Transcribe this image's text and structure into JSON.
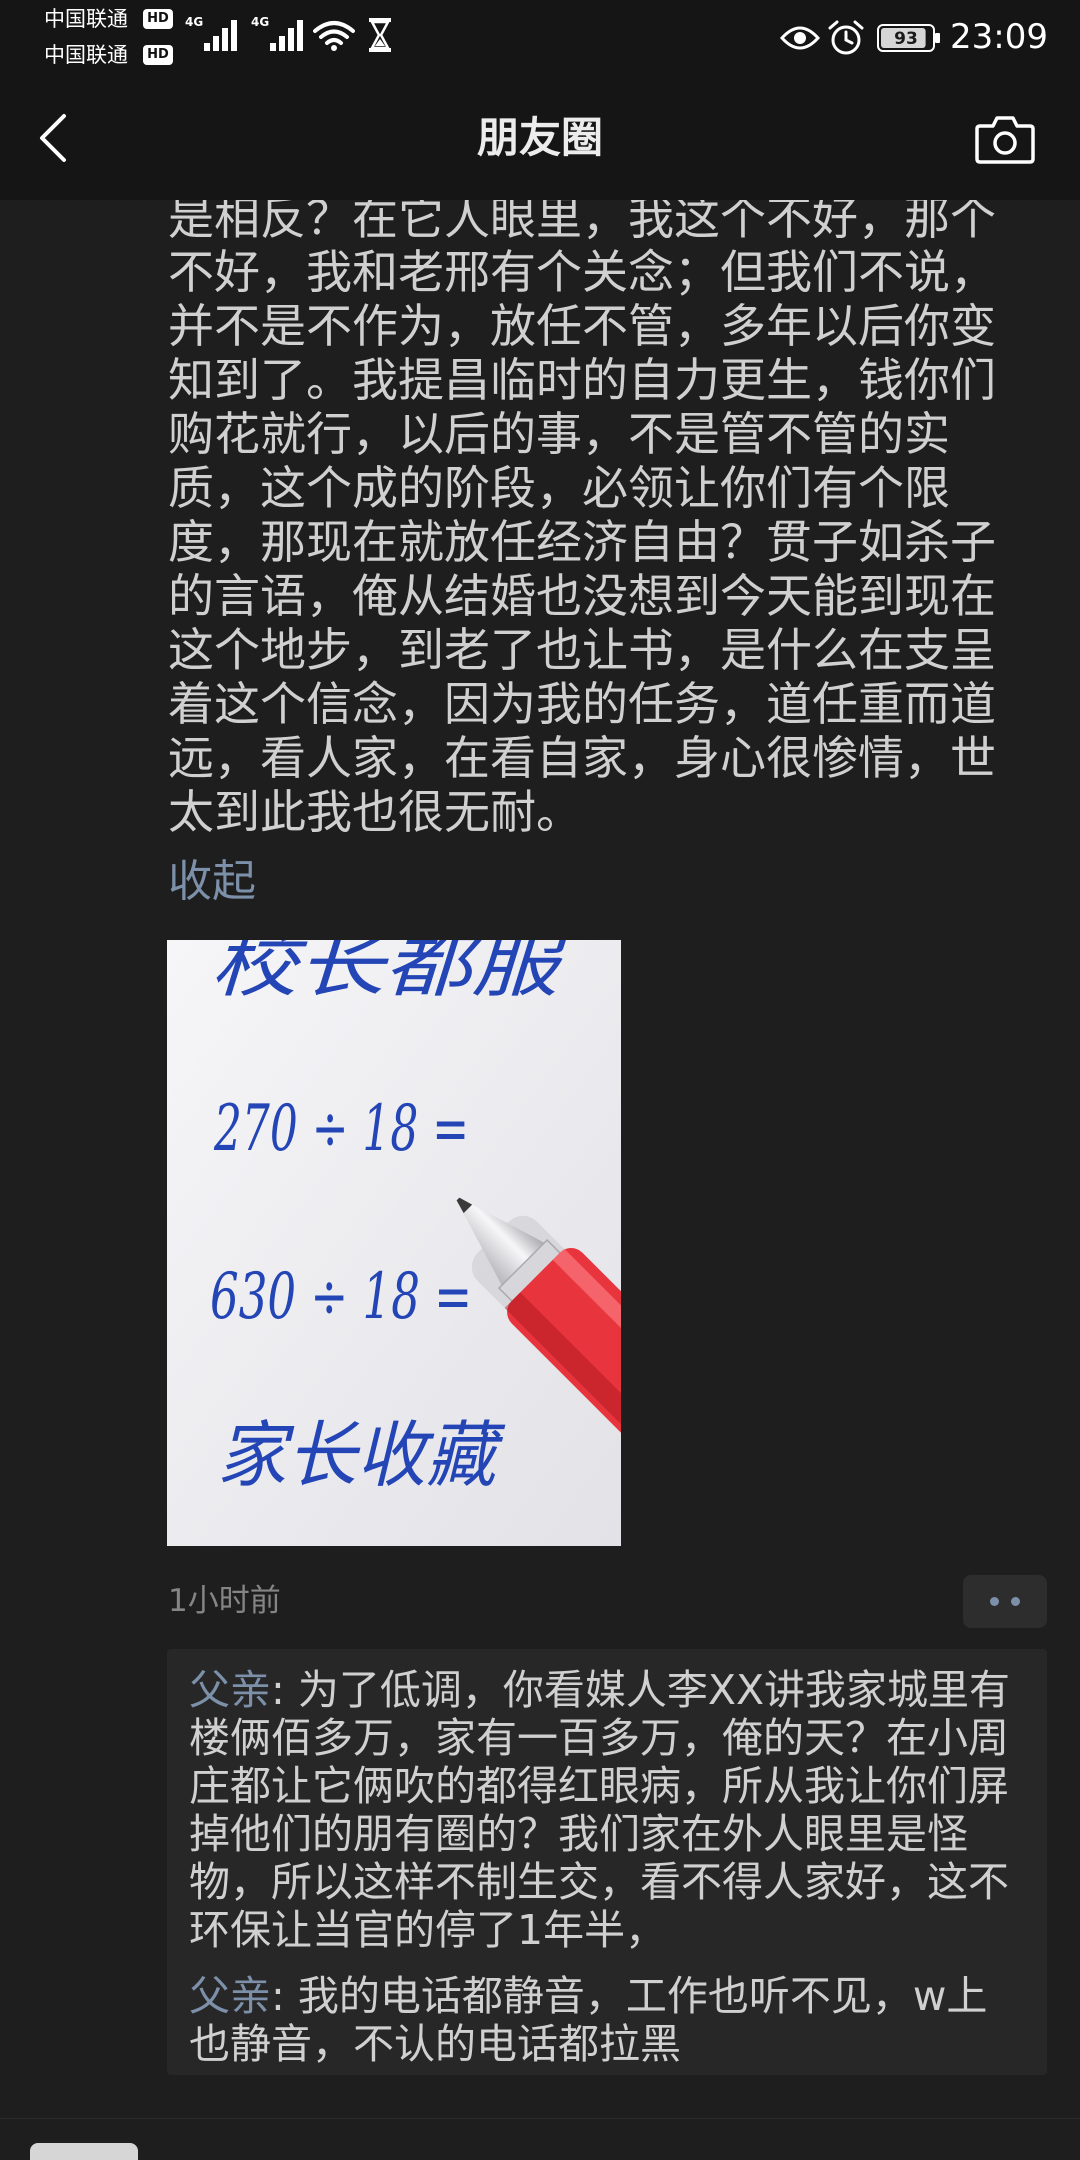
{
  "status_bar": {
    "carrier_primary": "中国联通",
    "carrier_secondary": "中国联通",
    "hd_badge_primary": "HD",
    "hd_badge_secondary": "HD",
    "network_primary": "4G",
    "network_secondary": "4G",
    "battery_percent": "93",
    "time": "23:09",
    "icons": [
      "signal-bars-icon",
      "wifi-icon",
      "hourglass-icon",
      "eye-icon",
      "alarm-clock-icon",
      "battery-icon"
    ]
  },
  "header": {
    "title": "朋友圈",
    "back_icon": "chevron-left-icon",
    "camera_icon": "camera-icon"
  },
  "post": {
    "text": "是相反？在它人眼里，我这个不好，那个不好，我和老邢有个关念；但我们不说，并不是不作为，放任不管，多年以后你变知到了。我提昌临时的自力更生，钱你们购花就行，以后的事，不是管不管的实质，这个成的阶段，必领让你们有个限度，那现在就放任经济自由？贯子如杀子的言语，俺从结婚也没想到今天能到现在这个地步，到老了也让书，是什么在支呈着这个信念，因为我的任务，道任重而道远，看人家，在看自家，身心很惨情，世太到此我也很无耐。",
    "collapse_label": "收起",
    "image": {
      "handwriting": [
        "校长都服",
        "270 ÷ 18 =",
        "630 ÷ 18 =",
        "家长收藏"
      ]
    },
    "timestamp": "1小时前",
    "more_icon": "more-dots-icon",
    "comments": [
      {
        "author": "父亲",
        "separator": ": ",
        "text": "为了低调，你看媒人李XX讲我家城里有楼俩佰多万，家有一百多万，俺的天？在小周庄都让它俩吹的都得红眼病，所从我让你们屏掉他们的朋有圈的？我们家在外人眼里是怪物，所以这样不制生交，看不得人家好，这不环保让当官的停了1年半，"
      },
      {
        "author": "父亲",
        "separator": ": ",
        "text": "我的电话都静音，工作也听不见，w上也静音，不认的电话都拉黑"
      }
    ]
  },
  "next_post": {
    "avatar_icon": "avatar-icon"
  },
  "colors": {
    "background": "#1e1e1e",
    "header_background": "#151515",
    "text_primary": "#d0d0d0",
    "text_secondary": "#858585",
    "link": "#7d90a9",
    "comment_background": "#272727",
    "button_background": "#2d2d2d",
    "ink_blue": "#2445b5",
    "pen_red": "#e8353d"
  }
}
